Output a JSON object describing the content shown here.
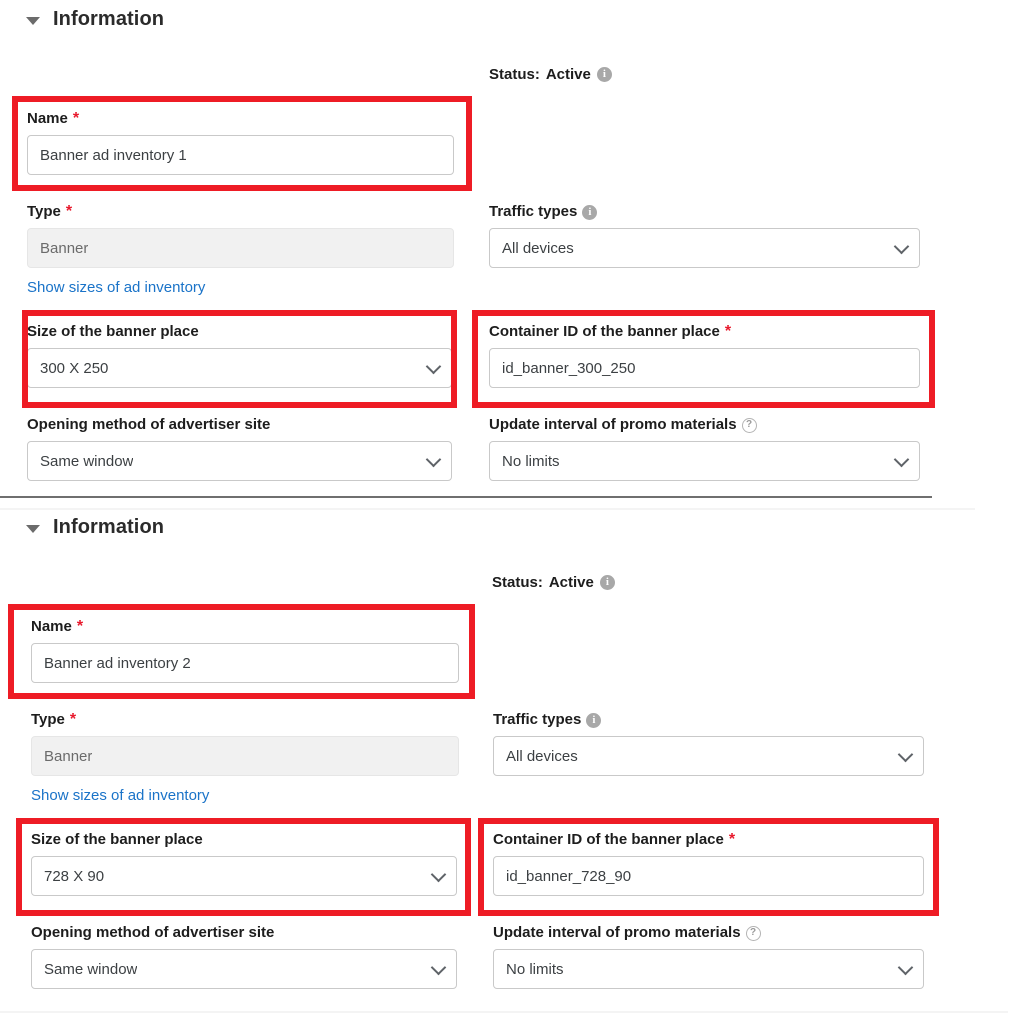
{
  "sections": [
    {
      "header": "Information",
      "status": {
        "label": "Status:",
        "value": "Active",
        "info_icon": "info-icon"
      },
      "name": {
        "label": "Name",
        "required": "*",
        "value": "Banner ad inventory 1"
      },
      "type": {
        "label": "Type",
        "required": "*",
        "value": "Banner"
      },
      "show_sizes_link": "Show sizes of ad inventory",
      "traffic_types": {
        "label": "Traffic types",
        "value": "All devices",
        "info_icon": "info-icon"
      },
      "size": {
        "label": "Size of the banner place",
        "value": "300 X 250"
      },
      "container_id": {
        "label": "Container ID of the banner place",
        "required": "*",
        "value": "id_banner_300_250"
      },
      "opening_method": {
        "label": "Opening method of advertiser site",
        "value": "Same window"
      },
      "update_interval": {
        "label": "Update interval of promo materials",
        "value": "No limits",
        "help_icon": "help-icon"
      }
    },
    {
      "header": "Information",
      "status": {
        "label": "Status:",
        "value": "Active",
        "info_icon": "info-icon"
      },
      "name": {
        "label": "Name",
        "required": "*",
        "value": "Banner ad inventory 2"
      },
      "type": {
        "label": "Type",
        "required": "*",
        "value": "Banner"
      },
      "show_sizes_link": "Show sizes of ad inventory",
      "traffic_types": {
        "label": "Traffic types",
        "value": "All devices",
        "info_icon": "info-icon"
      },
      "size": {
        "label": "Size of the banner place",
        "value": "728 X 90"
      },
      "container_id": {
        "label": "Container ID of the banner place",
        "required": "*",
        "value": "id_banner_728_90"
      },
      "opening_method": {
        "label": "Opening method of advertiser site",
        "value": "Same window"
      },
      "update_interval": {
        "label": "Update interval of promo materials",
        "value": "No limits",
        "help_icon": "help-icon"
      }
    }
  ],
  "icons": {
    "info": "i",
    "help": "?"
  },
  "colors": {
    "highlight": "#ee1c25",
    "required": "#e8192c",
    "link": "#1a73c8",
    "text": "#1d1d1d",
    "muted": "#6b6b6b"
  }
}
